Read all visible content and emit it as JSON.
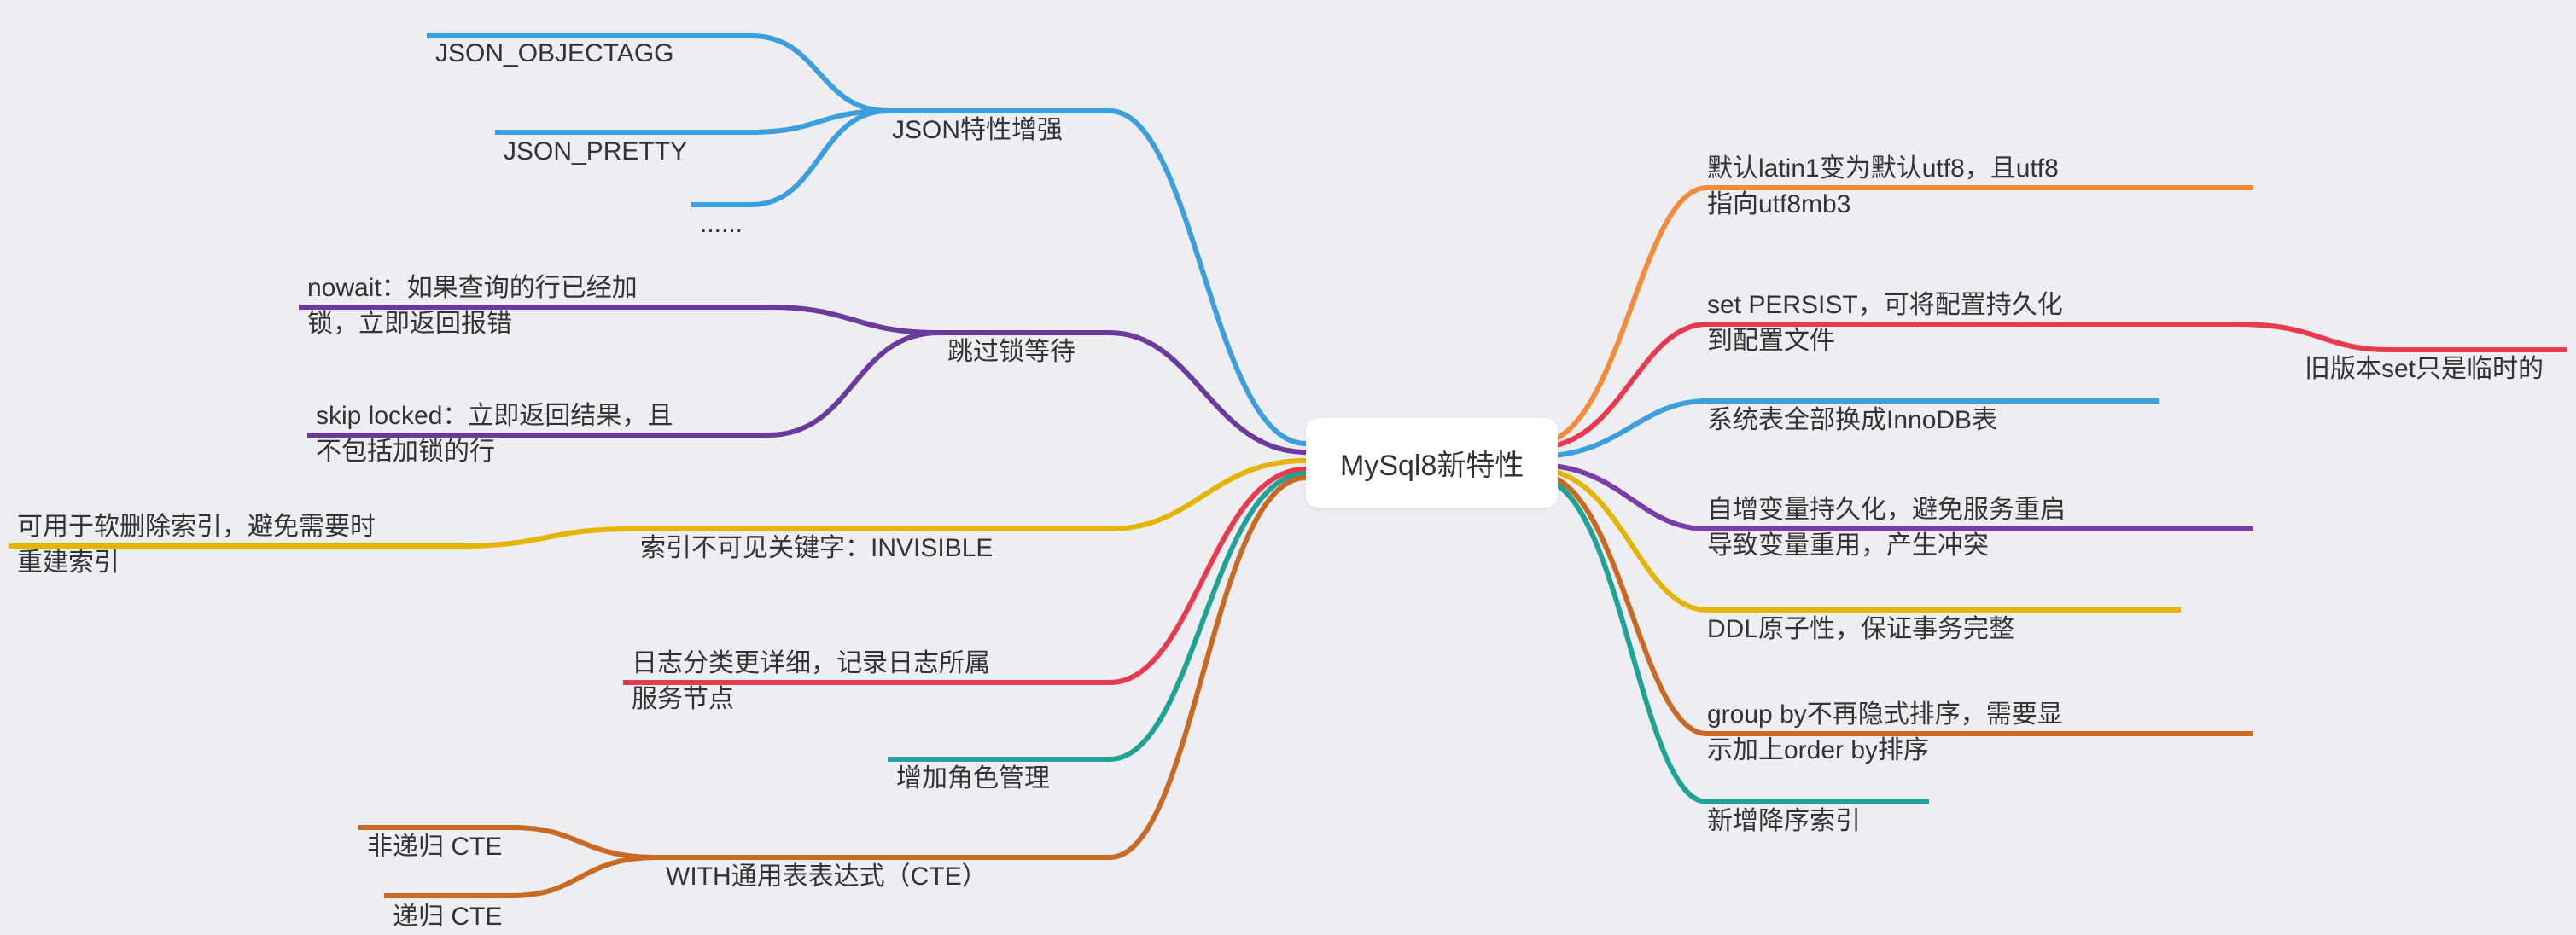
{
  "center": {
    "label": "MySql8新特性"
  },
  "left": [
    {
      "label": "JSON特性增强",
      "color": "#3a9fdc",
      "children": [
        {
          "label": "JSON_OBJECTAGG"
        },
        {
          "label": "JSON_PRETTY"
        },
        {
          "label": "......"
        }
      ]
    },
    {
      "label": "跳过锁等待",
      "color": "#6a3a9c",
      "children": [
        {
          "label": "nowait：如果查询的行已经加\n锁，立即返回报错"
        },
        {
          "label": "skip locked：立即返回结果，且\n不包括加锁的行"
        }
      ]
    },
    {
      "label": "索引不可见关键字：INVISIBLE",
      "color": "#e4b400",
      "children": [
        {
          "label": "可用于软删除索引，避免需要时\n重建索引"
        }
      ]
    },
    {
      "label": "日志分类更详细，记录日志所属\n服务节点",
      "color": "#e83a4f",
      "children": []
    },
    {
      "label": "增加角色管理",
      "color": "#1fa398",
      "children": []
    },
    {
      "label": "WITH通用表表达式（CTE）",
      "color": "#c96a24",
      "children": [
        {
          "label": "非递归 CTE"
        },
        {
          "label": "递归 CTE"
        }
      ]
    }
  ],
  "right": [
    {
      "label": "默认latin1变为默认utf8，且utf8\n指向utf8mb3",
      "color": "#f28c3a",
      "children": []
    },
    {
      "label": "set PERSIST，可将配置持久化\n到配置文件",
      "color": "#e83a4f",
      "children": [
        {
          "label": "旧版本set只是临时的"
        }
      ]
    },
    {
      "label": "系统表全部换成InnoDB表",
      "color": "#3a9fdc",
      "children": []
    },
    {
      "label": "自增变量持久化，避免服务重启\n导致变量重用，产生冲突",
      "color": "#7a3ea8",
      "children": []
    },
    {
      "label": "DDL原子性，保证事务完整",
      "color": "#e4b400",
      "children": []
    },
    {
      "label": "group by不再隐式排序，需要显\n示加上order by排序",
      "color": "#c96a24",
      "children": []
    },
    {
      "label": "新增降序索引",
      "color": "#1fa398",
      "children": []
    }
  ]
}
